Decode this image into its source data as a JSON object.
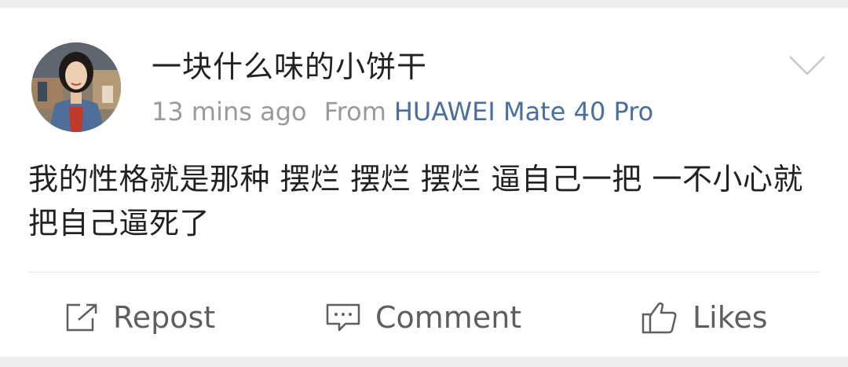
{
  "post": {
    "username": "一块什么味的小饼干",
    "time_ago": "13 mins ago",
    "from_label": "From",
    "device": "HUAWEI Mate 40 Pro",
    "content": "我的性格就是那种 摆烂 摆烂 摆烂 逼自己一把 一不小心就把自己逼死了"
  },
  "actions": {
    "repost_label": "Repost",
    "comment_label": "Comment",
    "likes_label": "Likes"
  },
  "icons": {
    "expand": "chevron-down-icon",
    "repost": "share-square-icon",
    "comment": "comment-bubble-icon",
    "likes": "thumbs-up-icon"
  },
  "colors": {
    "device_link": "#4a6f9c",
    "meta_text": "#9a9a9a",
    "primary_text": "#222222",
    "action_text": "#5f5f5f"
  }
}
